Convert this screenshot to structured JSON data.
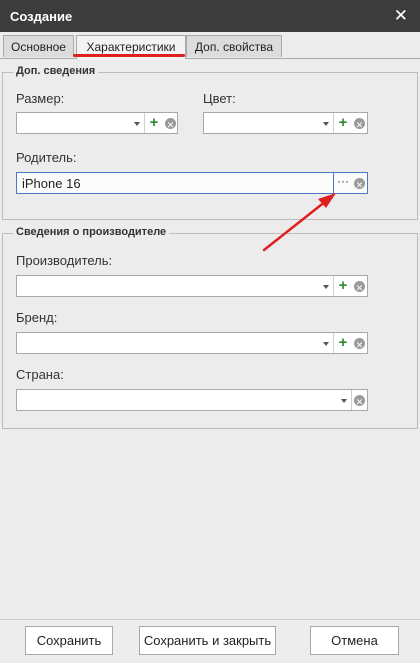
{
  "window": {
    "title": "Создание"
  },
  "tabs": [
    {
      "label": "Основное"
    },
    {
      "label": "Характеристики"
    },
    {
      "label": "Доп. свойства"
    }
  ],
  "extra_info": {
    "title": "Доп. сведения",
    "size_label": "Размер:",
    "size_value": "",
    "color_label": "Цвет:",
    "color_value": "",
    "parent_label": "Родитель:",
    "parent_value": "iPhone 16",
    "parent_browse_button": "···"
  },
  "manufacturer_info": {
    "title": "Сведения о производителе",
    "manufacturer_label": "Производитель:",
    "manufacturer_value": "",
    "brand_label": "Бренд:",
    "brand_value": "",
    "country_label": "Страна:",
    "country_value": ""
  },
  "footer": {
    "save_label": "Сохранить",
    "save_close_label": "Сохранить и закрыть",
    "cancel_label": "Отмена"
  },
  "colors": {
    "active_tab_underline": "#e02020",
    "annotation_arrow": "#e02020",
    "add_icon": "#2f8a2f"
  }
}
